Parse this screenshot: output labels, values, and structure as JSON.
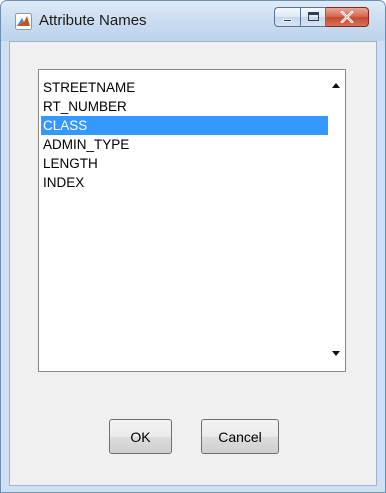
{
  "window": {
    "title": "Attribute Names",
    "icon": "matlab-icon",
    "controls": [
      "minimize-icon",
      "maximize-icon",
      "close-icon"
    ],
    "close_color": "#c75a3e"
  },
  "list": {
    "items": [
      "STREETNAME",
      "RT_NUMBER",
      "CLASS",
      "ADMIN_TYPE",
      "LENGTH",
      "INDEX"
    ],
    "selected": "CLASS",
    "selection_color": "#3399ff"
  },
  "buttons": {
    "ok_label": "OK",
    "cancel_label": "Cancel"
  }
}
